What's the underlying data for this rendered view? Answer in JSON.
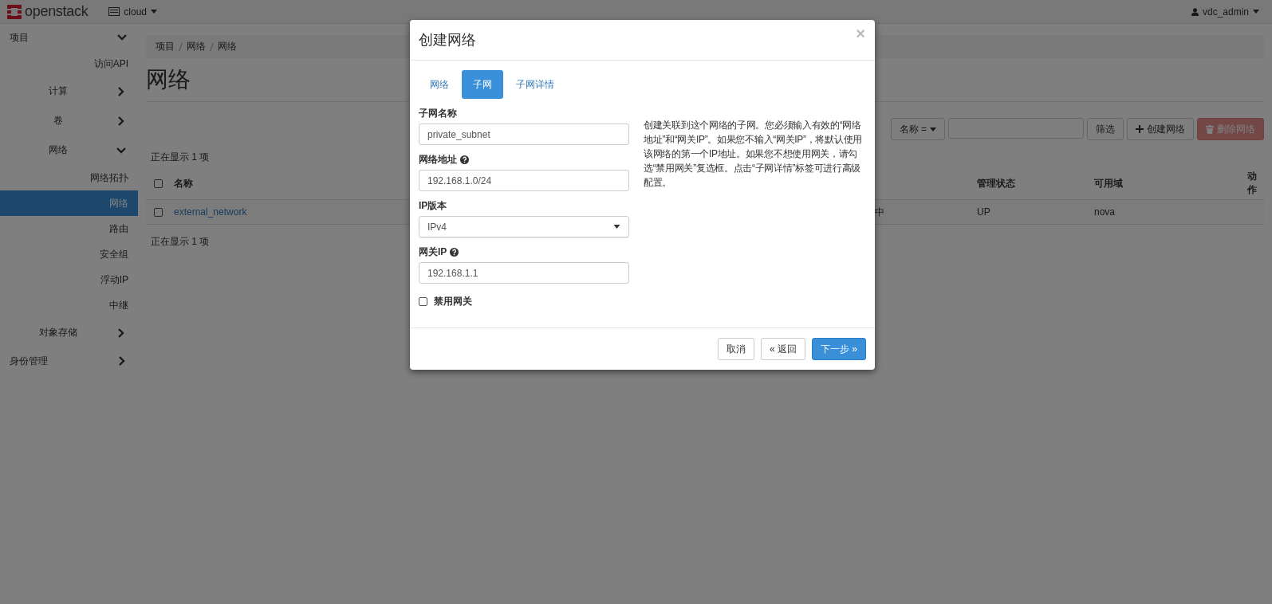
{
  "topbar": {
    "brand": "openstack",
    "project": "cloud",
    "user": "vdc_admin"
  },
  "sidebar": [
    {
      "label": "项目",
      "expanded": true,
      "children": [
        {
          "label": "访问API",
          "selected": false
        },
        {
          "label": "计算",
          "expanded": false
        },
        {
          "label": "卷",
          "expanded": false
        },
        {
          "label": "网络",
          "expanded": true,
          "children": [
            {
              "label": "网络拓扑",
              "selected": false
            },
            {
              "label": "网络",
              "selected": true
            },
            {
              "label": "路由",
              "selected": false
            },
            {
              "label": "安全组",
              "selected": false
            },
            {
              "label": "浮动IP",
              "selected": false
            },
            {
              "label": "中继",
              "selected": false
            }
          ]
        },
        {
          "label": "对象存储",
          "expanded": false
        }
      ]
    },
    {
      "label": "身份管理",
      "expanded": false
    }
  ],
  "breadcrumb": [
    "项目",
    "网络",
    "网络"
  ],
  "page_title": "网络",
  "filter": {
    "field": "名称 =",
    "buttons": [
      {
        "label": "筛选",
        "kind": "plain",
        "disabled": false
      },
      {
        "label": "创建网络",
        "kind": "create",
        "disabled": false
      },
      {
        "label": "删除网络",
        "kind": "delete",
        "disabled": true
      }
    ]
  },
  "table": {
    "count_top": "正在显示 1 项",
    "count_bottom": "正在显示 1 项",
    "header_checked": false,
    "columns": [
      {
        "label": "名称"
      },
      {
        "label": "管理状态"
      },
      {
        "label": "可用域"
      },
      {
        "label": "动作"
      }
    ],
    "rows": [
      {
        "checked": false,
        "name": "external_network",
        "column_3": "中",
        "admin_state": "UP",
        "availability_zone": "nova"
      }
    ]
  },
  "modal": {
    "title": "创建网络",
    "close": "×",
    "tabs": [
      {
        "label": "网络",
        "selected": false
      },
      {
        "label": "子网",
        "selected": true
      },
      {
        "label": "子网详情",
        "selected": false
      }
    ],
    "fields": [
      {
        "kind": "text",
        "label": "子网名称",
        "help": false,
        "value": "private_subnet"
      },
      {
        "kind": "text",
        "label": "网络地址",
        "help": true,
        "value": "192.168.1.0/24"
      },
      {
        "kind": "select",
        "label": "IP版本",
        "help": false,
        "value": "IPv4"
      },
      {
        "kind": "text",
        "label": "网关IP",
        "help": true,
        "value": "192.168.1.1"
      },
      {
        "kind": "checkbox",
        "label": "禁用网关",
        "checked": false
      }
    ],
    "description": "创建关联到这个网络的子网。您必须输入有效的“网络地址”和“网关IP”。如果您不输入“网关IP”，将默认使用该网络的第一个IP地址。如果您不想使用网关，请勾选“禁用网关”复选框。点击“子网详情”标签可进行高级配置。",
    "buttons": [
      {
        "label": "取消",
        "kind": "default"
      },
      {
        "label": "« 返回",
        "kind": "default"
      },
      {
        "label": "下一步 »",
        "kind": "primary"
      }
    ]
  }
}
